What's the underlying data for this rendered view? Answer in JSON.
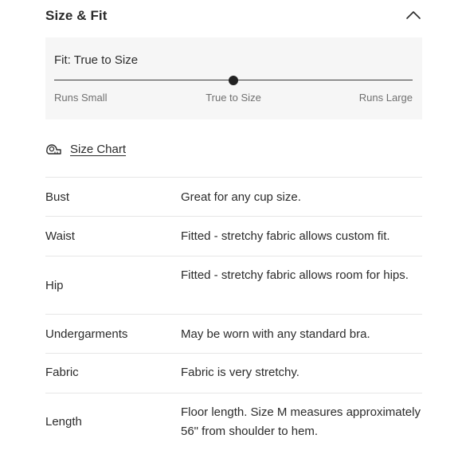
{
  "section": {
    "title": "Size & Fit",
    "collapse_icon": "chevron-up-icon"
  },
  "fit": {
    "label": "Fit: True to Size",
    "scale": [
      "Runs Small",
      "True to Size",
      "Runs Large"
    ],
    "position_fraction": 0.5
  },
  "size_chart": {
    "label": "Size Chart",
    "icon": "measuring-tape-icon"
  },
  "specs": [
    {
      "key": "Bust",
      "value": "Great for any cup size."
    },
    {
      "key": "Waist",
      "value": "Fitted - stretchy fabric allows custom fit."
    },
    {
      "key": "Hip",
      "value": "Fitted - stretchy fabric allows room for hips."
    },
    {
      "key": "Undergarments",
      "value": "May be worn with any standard bra."
    },
    {
      "key": "Fabric",
      "value": "Fabric is very stretchy."
    },
    {
      "key": "Length",
      "value": "Floor length. Size M measures approximately 56\" from shoulder to hem."
    }
  ],
  "colors": {
    "panel_background": "#f6f6f6",
    "divider": "#e6e6e6",
    "text": "#2b2b2b",
    "muted_text": "#707070",
    "marker": "#222222"
  }
}
